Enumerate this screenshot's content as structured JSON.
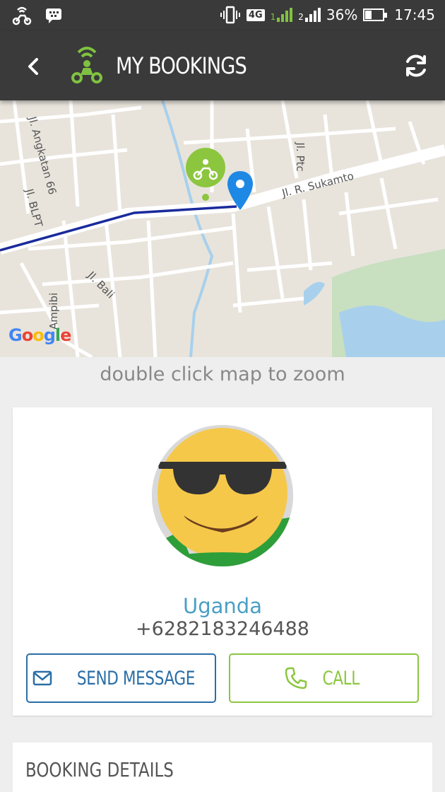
{
  "status_bar": {
    "network": "4G",
    "sim1": "1",
    "sim2": "2",
    "battery_text": "36%",
    "battery_level": 0.36,
    "time": "17:45"
  },
  "app_bar": {
    "title": "MY BOOKINGS",
    "icons": {
      "back": "back-arrow-icon",
      "logo": "motorbike-logo-icon",
      "refresh": "refresh-icon"
    }
  },
  "map": {
    "streets": {
      "angkatan": "Jl. Angkatan 66",
      "blpt": "Jl. BLPT",
      "ptc": "Jl. Ptc",
      "sukamto": "Jl. R. Sukamto",
      "bali": "Jl. Bali",
      "ampibi": "Ampibi"
    },
    "attribution": {
      "g1": "G",
      "o1": "o",
      "o2": "o",
      "g2": "g",
      "l": "l",
      "e": "e"
    },
    "colors": {
      "route": "#1a2a9c",
      "pin": "#1e88e5",
      "driver": "#8cc63f",
      "park": "#c8dfc0",
      "water": "#a8d0ec"
    }
  },
  "zoom_hint": "double click map to zoom",
  "driver": {
    "name": "Uganda",
    "phone": "+6282183246488",
    "send_message_label": "SEND MESSAGE",
    "call_label": "CALL"
  },
  "booking_details": {
    "title": "BOOKING DETAILS"
  }
}
